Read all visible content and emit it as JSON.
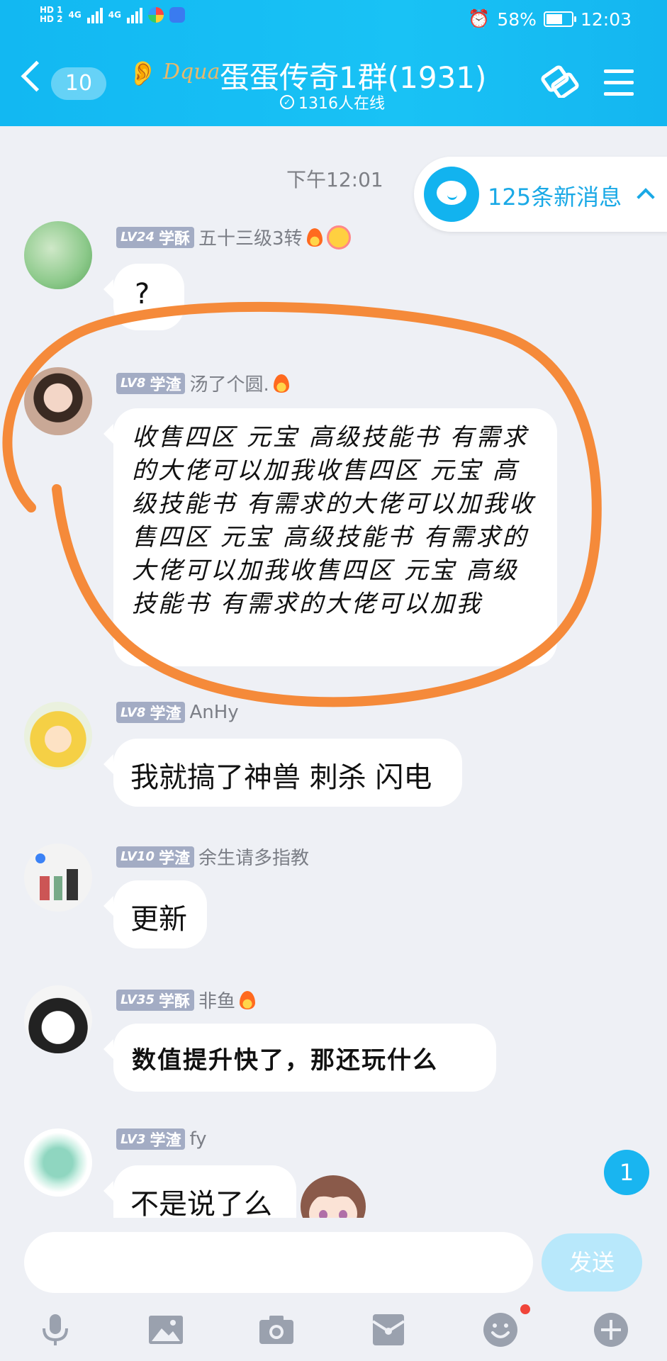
{
  "status_bar": {
    "left_labels": [
      "HD 1",
      "HD 2",
      "4G",
      "4G"
    ],
    "battery": "58%",
    "battery_level": 0.58,
    "time": "12:03"
  },
  "header": {
    "back_count": "10",
    "logo_text": "Dqua",
    "title": "蛋蛋传奇1群(1931)",
    "online": "1316人在线"
  },
  "chat": {
    "time_label": "下午12:01",
    "new_messages": "125条新消息",
    "messages": [
      {
        "level": "LV24",
        "rank": "学酥",
        "name": "五十三级3转",
        "text": "?"
      },
      {
        "level": "LV8",
        "rank": "学渣",
        "name": "汤了个圆.",
        "text": "收售四区 元宝 高级技能书 有需求的大佬可以加我收售四区 元宝 高级技能书 有需求的大佬可以加我收售四区 元宝 高级技能书 有需求的大佬可以加我收售四区 元宝 高级技能书 有需求的大佬可以加我"
      },
      {
        "level": "LV8",
        "rank": "学渣",
        "name": "AnHy",
        "text": "我就搞了神兽  刺杀 闪电"
      },
      {
        "level": "LV10",
        "rank": "学渣",
        "name": "余生请多指教",
        "text": "更新"
      },
      {
        "level": "LV35",
        "rank": "学酥",
        "name": "非鱼",
        "text": "数值提升快了，那还玩什么"
      },
      {
        "level": "LV3",
        "rank": "学渣",
        "name": "fy",
        "text": "不是说了么"
      }
    ],
    "unread_fab": "1"
  },
  "input": {
    "send_label": "发送"
  },
  "colors": {
    "accent": "#12b8f2",
    "badge": "#a3acc4",
    "annotation": "#f58a3a"
  }
}
